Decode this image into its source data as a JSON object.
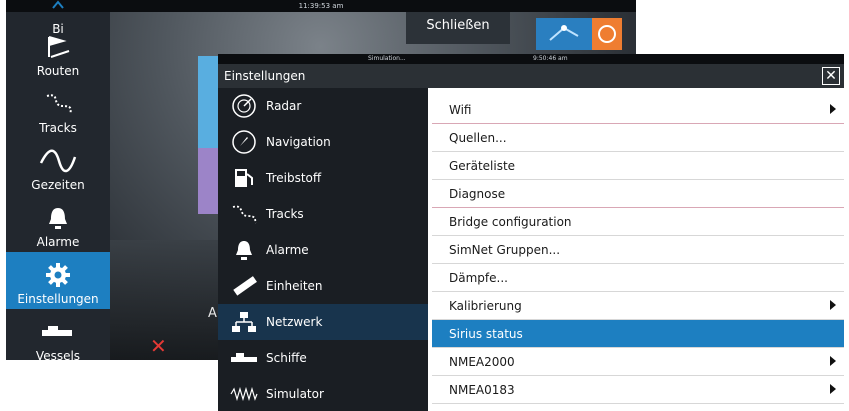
{
  "background_screen": {
    "clock": "11:39:53 am",
    "close_label": "Schließen",
    "sidebar_items": [
      {
        "label": "Bi",
        "icon": "chevron-up-icon"
      },
      {
        "label": "Routen",
        "icon": "route-flag-icon"
      },
      {
        "label": "Tracks",
        "icon": "track-icon"
      },
      {
        "label": "Gezeiten",
        "icon": "tide-wave-icon"
      },
      {
        "label": "Alarme",
        "icon": "bell-icon"
      },
      {
        "label": "Einstellungen",
        "icon": "gear-icon"
      },
      {
        "label": "Vessels",
        "icon": "vessel-icon"
      }
    ],
    "partial_label": "Au"
  },
  "dialog": {
    "status_sim": "Simulation...",
    "status_time": "9:50:46 am",
    "title": "Einstellungen",
    "categories": [
      {
        "label": "Radar",
        "icon": "radar-icon"
      },
      {
        "label": "Navigation",
        "icon": "compass-icon"
      },
      {
        "label": "Treibstoff",
        "icon": "fuel-pump-icon"
      },
      {
        "label": "Tracks",
        "icon": "track-icon"
      },
      {
        "label": "Alarme",
        "icon": "bell-icon"
      },
      {
        "label": "Einheiten",
        "icon": "ruler-icon"
      },
      {
        "label": "Netzwerk",
        "icon": "network-icon"
      },
      {
        "label": "Schiffe",
        "icon": "vessel-icon"
      },
      {
        "label": "Simulator",
        "icon": "simulator-wave-icon"
      }
    ],
    "active_category": "Netzwerk",
    "items": [
      {
        "label": "Wifi",
        "submenu": true
      },
      {
        "label": "Quellen...",
        "submenu": false
      },
      {
        "label": "Geräteliste",
        "submenu": false
      },
      {
        "label": "Diagnose",
        "submenu": false
      },
      {
        "label": "Bridge configuration",
        "submenu": false
      },
      {
        "label": "SimNet Gruppen...",
        "submenu": false
      },
      {
        "label": "Dämpfe...",
        "submenu": false
      },
      {
        "label": "Kalibrierung",
        "submenu": true
      },
      {
        "label": "Sirius status",
        "submenu": false
      },
      {
        "label": "NMEA2000",
        "submenu": true
      },
      {
        "label": "NMEA0183",
        "submenu": true
      }
    ],
    "selected_item": "Sirius status"
  },
  "colors": {
    "accent": "#1d7fc1",
    "dark_panel": "#1a1e23",
    "active_category_bg": "#18344d"
  }
}
